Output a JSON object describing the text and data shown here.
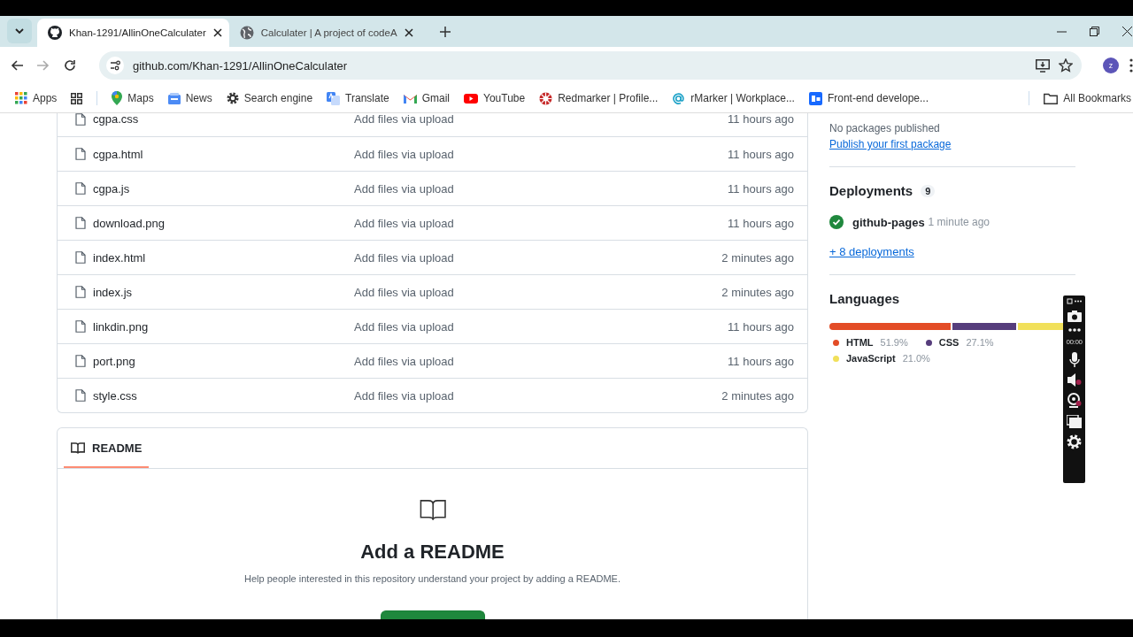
{
  "browser": {
    "tabs": [
      {
        "title": "Khan-1291/AllinOneCalculater",
        "selected": true,
        "kind": "github"
      },
      {
        "title": "Calculater | A project of codeA",
        "selected": false,
        "kind": "globe"
      }
    ],
    "address": "github.com/Khan-1291/AllinOneCalculater",
    "profile_initial": "z",
    "bookmarks": [
      {
        "label": "Apps",
        "kind": "apps"
      },
      {
        "label": "Maps",
        "kind": "maps"
      },
      {
        "label": "News",
        "kind": "news"
      },
      {
        "label": "Search engine",
        "kind": "gear"
      },
      {
        "label": "Translate",
        "kind": "translate"
      },
      {
        "label": "Gmail",
        "kind": "mail"
      },
      {
        "label": "YouTube",
        "kind": "video"
      },
      {
        "label": "Redmarker | Profile...",
        "kind": "wheel"
      },
      {
        "label": "rMarker | Workplace...",
        "kind": "at"
      },
      {
        "label": "Front-end develope...",
        "kind": "be"
      }
    ],
    "all_bookmarks": "All Bookmarks"
  },
  "files": [
    {
      "name": "cgpa.css",
      "message": "Add files via upload",
      "time": "11 hours ago"
    },
    {
      "name": "cgpa.html",
      "message": "Add files via upload",
      "time": "11 hours ago"
    },
    {
      "name": "cgpa.js",
      "message": "Add files via upload",
      "time": "11 hours ago"
    },
    {
      "name": "download.png",
      "message": "Add files via upload",
      "time": "11 hours ago"
    },
    {
      "name": "index.html",
      "message": "Add files via upload",
      "time": "2 minutes ago"
    },
    {
      "name": "index.js",
      "message": "Add files via upload",
      "time": "2 minutes ago"
    },
    {
      "name": "linkdin.png",
      "message": "Add files via upload",
      "time": "11 hours ago"
    },
    {
      "name": "port.png",
      "message": "Add files via upload",
      "time": "11 hours ago"
    },
    {
      "name": "style.css",
      "message": "Add files via upload",
      "time": "2 minutes ago"
    }
  ],
  "readme": {
    "tab": "README",
    "title": "Add a README",
    "text": "Help people interested in this repository understand your project by adding a README."
  },
  "packages": {
    "empty_text": "No packages published",
    "link": "Publish your first package"
  },
  "deployments": {
    "title": "Deployments",
    "count": "9",
    "items": [
      {
        "name": "github-pages",
        "time": "1 minute ago"
      }
    ],
    "more": "+ 8 deployments"
  },
  "languages": {
    "title": "Languages",
    "items": [
      {
        "name": "HTML",
        "percent": "51.9%",
        "color": "#e34c26"
      },
      {
        "name": "CSS",
        "percent": "27.1%",
        "color": "#563d7c"
      },
      {
        "name": "JavaScript",
        "percent": "21.0%",
        "color": "#f1e05a"
      }
    ]
  },
  "recorder": {
    "timer": "00:00"
  }
}
